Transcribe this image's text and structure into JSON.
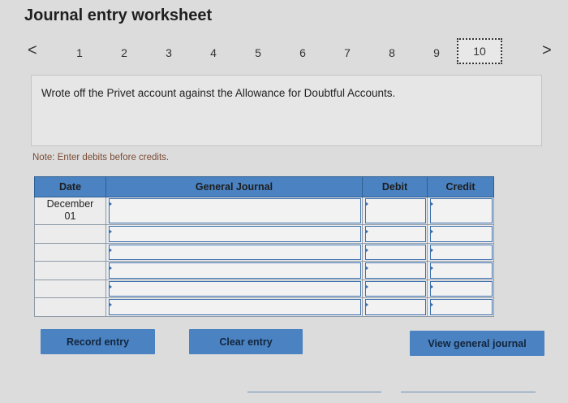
{
  "page": {
    "title": "Journal entry worksheet"
  },
  "nav": {
    "prev_icon": "chevron-left-icon",
    "next_icon": "chevron-right-icon",
    "prev_glyph": "<",
    "next_glyph": ">",
    "steps": [
      "1",
      "2",
      "3",
      "4",
      "5",
      "6",
      "7",
      "8",
      "9",
      "10"
    ],
    "current_step": "10"
  },
  "description": "Wrote off the Privet account against the Allowance for Doubtful Accounts.",
  "note": "Note: Enter debits before credits.",
  "table": {
    "headers": {
      "date": "Date",
      "journal": "General Journal",
      "debit": "Debit",
      "credit": "Credit"
    },
    "rows": [
      {
        "date_line1": "December",
        "date_line2": "01"
      },
      {
        "date_line1": "",
        "date_line2": ""
      },
      {
        "date_line1": "",
        "date_line2": ""
      },
      {
        "date_line1": "",
        "date_line2": ""
      },
      {
        "date_line1": "",
        "date_line2": ""
      },
      {
        "date_line1": "",
        "date_line2": ""
      }
    ]
  },
  "buttons": {
    "record": "Record entry",
    "clear": "Clear entry",
    "view": "View general journal"
  },
  "colors": {
    "accent": "#4a82c2",
    "background": "#dcdcdc",
    "note": "#7a4b35"
  }
}
